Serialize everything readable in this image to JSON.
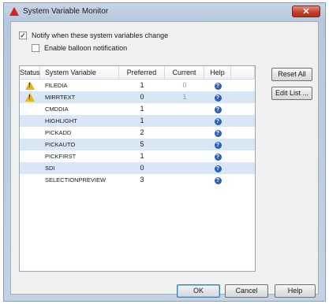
{
  "window": {
    "title": "System Variable Monitor",
    "close_glyph": "✕"
  },
  "options": {
    "notify_label": "Notify when these system variables change",
    "notify_checked": true,
    "balloon_label": "Enable balloon notification",
    "balloon_checked": false
  },
  "grid": {
    "columns": {
      "status": "Status",
      "variable": "System Variable",
      "preferred": "Preferred",
      "current": "Current",
      "help": "Help"
    },
    "rows": [
      {
        "warning": true,
        "variable": "FILEDIA",
        "preferred": "1",
        "current": "0"
      },
      {
        "warning": true,
        "variable": "MIRRTEXT",
        "preferred": "0",
        "current": "1"
      },
      {
        "warning": false,
        "variable": "CMDDIA",
        "preferred": "1",
        "current": ""
      },
      {
        "warning": false,
        "variable": "HIGHLIGHT",
        "preferred": "1",
        "current": ""
      },
      {
        "warning": false,
        "variable": "PICKADD",
        "preferred": "2",
        "current": ""
      },
      {
        "warning": false,
        "variable": "PICKAUTO",
        "preferred": "5",
        "current": ""
      },
      {
        "warning": false,
        "variable": "PICKFIRST",
        "preferred": "1",
        "current": ""
      },
      {
        "warning": false,
        "variable": "SDI",
        "preferred": "0",
        "current": ""
      },
      {
        "warning": false,
        "variable": "SELECTIONPREVIEW",
        "preferred": "3",
        "current": ""
      }
    ]
  },
  "buttons": {
    "reset_all": "Reset All",
    "edit_list": "Edit List ...",
    "ok": "OK",
    "cancel": "Cancel",
    "help": "Help"
  },
  "colors": {
    "warning": "#e8b516",
    "help_icon": "#2f5fb5",
    "row_alt": "#d9e6f5"
  }
}
